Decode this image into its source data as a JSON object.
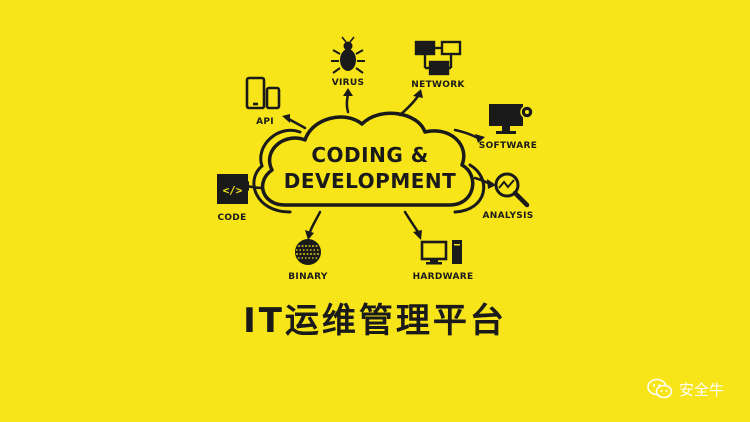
{
  "diagram": {
    "center": {
      "line1": "CODING &",
      "line2": "DEVELOPMENT"
    },
    "nodes": {
      "virus": "VIRUS",
      "network": "NETWORK",
      "api": "API",
      "software": "SOFTWARE",
      "code": "CODE",
      "analysis": "ANALYSIS",
      "binary": "BINARY",
      "hardware": "HARDWARE"
    }
  },
  "title": "IT运维管理平台",
  "watermark": {
    "text": "安全牛",
    "icon": "wechat-icon"
  },
  "colors": {
    "background": "#f7e419",
    "ink": "#1a1a1a",
    "watermark": "#ffffff"
  }
}
